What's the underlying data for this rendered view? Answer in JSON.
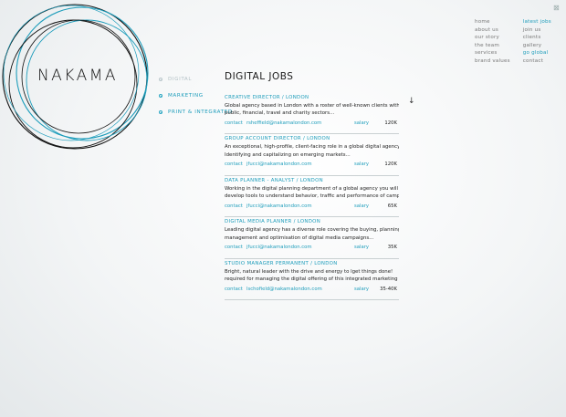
{
  "brand": {
    "logo_text": "NAKAMA"
  },
  "side_nav": [
    {
      "label": "DIGITAL",
      "state": "inactive"
    },
    {
      "label": "MARKETING",
      "state": "active"
    },
    {
      "label": "PRINT & INTEGRATED",
      "state": "active"
    }
  ],
  "top_nav": {
    "col1": [
      "home",
      "about us",
      "our story",
      "the team",
      "services",
      "brand values"
    ],
    "col2": [
      "latest jobs",
      "join us",
      "clients",
      "gallery",
      "go global",
      "contact"
    ]
  },
  "page_title": "DIGITAL JOBS",
  "arrow": "↓",
  "close_glyph": "⊠",
  "labels": {
    "contact": "contact",
    "salary": "salary"
  },
  "jobs": [
    {
      "title": "CREATIVE DIRECTOR / LONDON",
      "desc1": "Global agency based in London with a roster of well-known clients within the",
      "desc2": "public, financial, travel and charity sectors...",
      "email": "rsheffield@nakamalondon.com",
      "salary": "120K"
    },
    {
      "title": "GROUP ACCOUNT DIRECTOR / LONDON",
      "desc1": "An exceptional, high-profile, client-facing role in a global digital agency.",
      "desc2": "Identifying and capitalizing on emerging markets...",
      "email": "jfucci@nakamalondon.com",
      "salary": "120K"
    },
    {
      "title": "DATA PLANNER - ANALYST / LONDON",
      "desc1": "Working in the digital planning department of a global agency you will",
      "desc2": "develop tools to understand behavior, traffic and performance of campaigns",
      "email": "jfucci@nakamalondon.com",
      "salary": "65K"
    },
    {
      "title": "DIGITAL MEDIA PLANNER / LONDON",
      "desc1": "Leading digital agency has a diverse role covering the buying, planning,",
      "desc2": "management and optimisation of digital media campaigns...",
      "email": "jfucci@nakamalondon.com",
      "salary": "35K"
    },
    {
      "title": "STUDIO MANAGER PERMANENT / LONDON",
      "desc1": "Bright, natural leader with the drive and energy to lget things done!",
      "desc2": "required for managing the digital offering of this integrated marketing",
      "email": "lschofield@nakamalondon.com",
      "salary": "35-40K"
    }
  ]
}
